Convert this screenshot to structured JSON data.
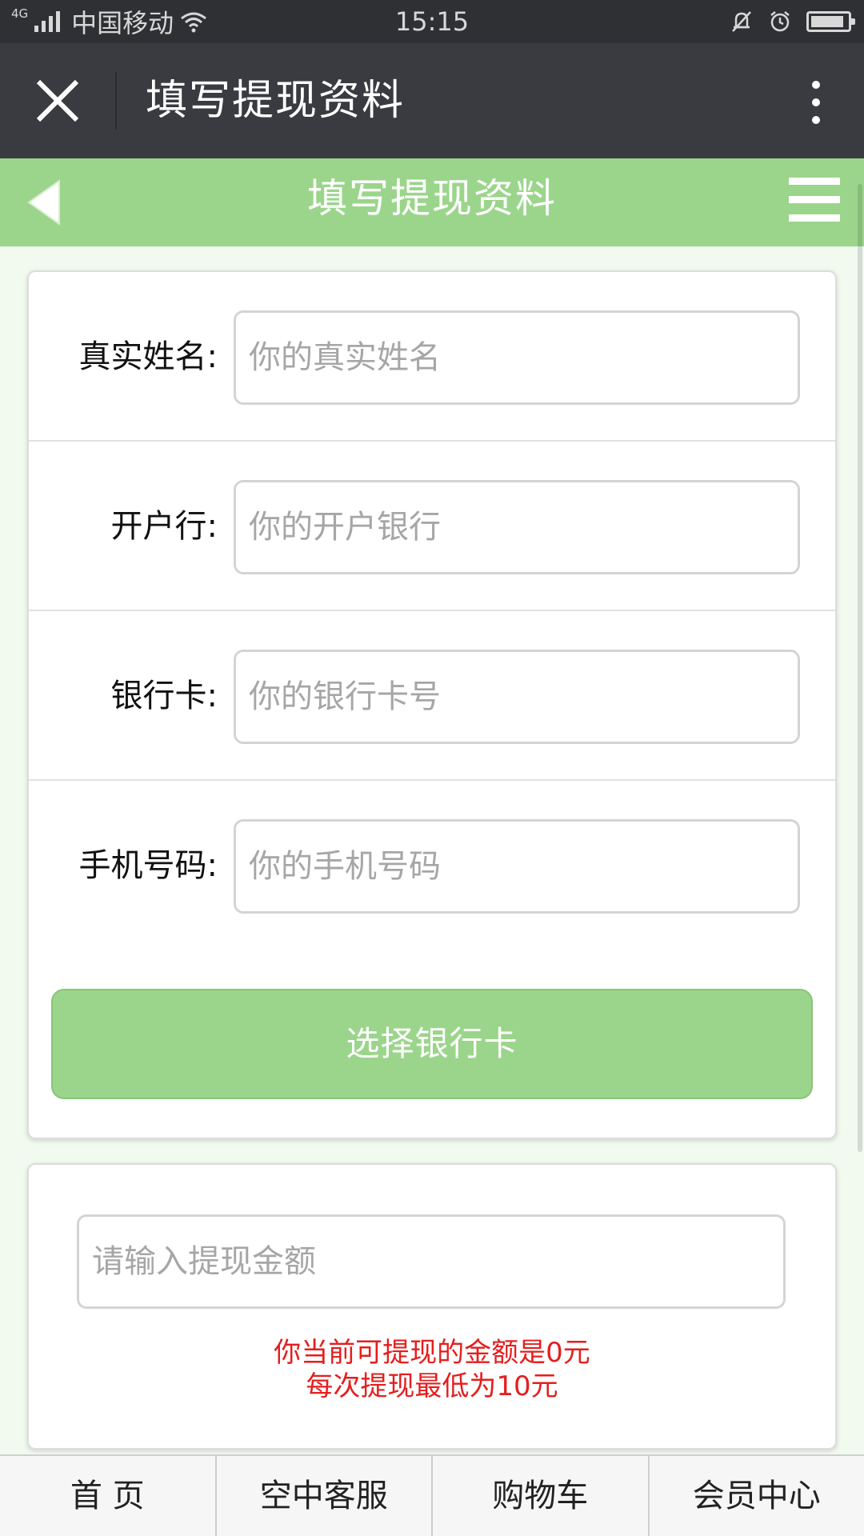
{
  "status_bar": {
    "network_type": "4G",
    "carrier": "中国移动",
    "time": "15:15",
    "battery_level": 0.9
  },
  "titlebar": {
    "title": "填写提现资料",
    "close_icon": "close-icon",
    "more_icon": "more-vertical-icon"
  },
  "header": {
    "title": "填写提现资料",
    "back_icon": "back-triangle-icon",
    "menu_icon": "hamburger-menu-icon",
    "bg_color": "#9bd58b"
  },
  "form": {
    "fields": [
      {
        "label": "真实姓名:",
        "placeholder": "你的真实姓名",
        "value": ""
      },
      {
        "label": "开户行:",
        "placeholder": "你的开户银行",
        "value": ""
      },
      {
        "label": "银行卡:",
        "placeholder": "你的银行卡号",
        "value": ""
      },
      {
        "label": "手机号码:",
        "placeholder": "你的手机号码",
        "value": ""
      }
    ],
    "select_card_label": "选择银行卡"
  },
  "withdraw": {
    "amount_placeholder": "请输入提现金额",
    "amount_value": "",
    "notice_line1": "你当前可提现的金额是0元",
    "notice_line2": "每次提现最低为10元",
    "notice_color": "#e51e1e"
  },
  "bottom_nav": {
    "items": [
      {
        "label": "首 页"
      },
      {
        "label": "空中客服"
      },
      {
        "label": "购物车"
      },
      {
        "label": "会员中心"
      }
    ]
  }
}
